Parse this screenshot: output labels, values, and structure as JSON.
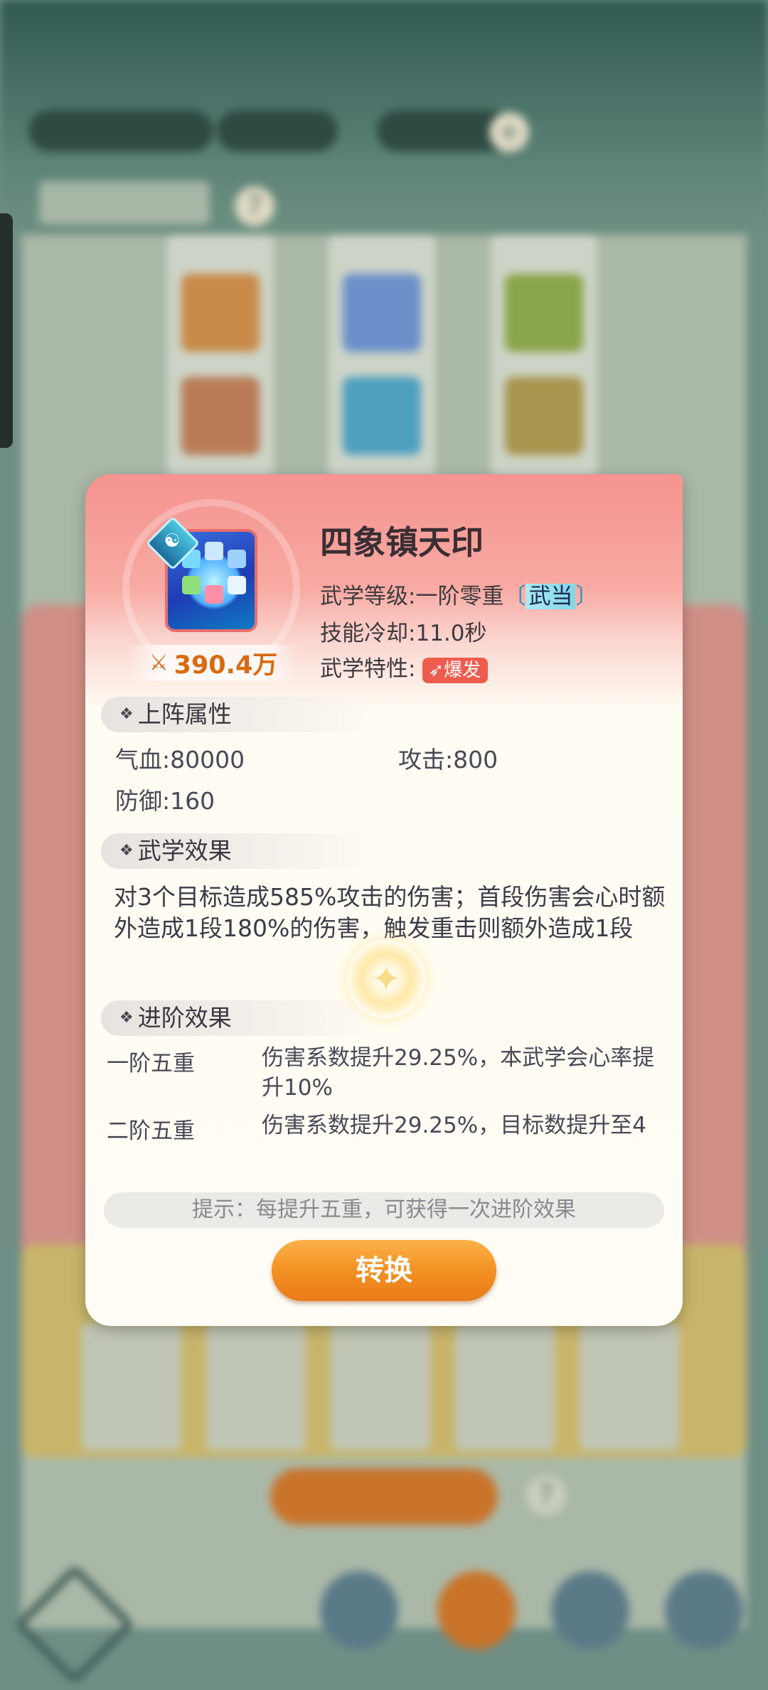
{
  "background": {
    "res_labels": [
      "",
      "",
      ""
    ],
    "title": "",
    "help": "?",
    "bottom_button": "",
    "bottom_help": "?"
  },
  "modal": {
    "skill_name": "四象镇天印",
    "power_value": "390.4万",
    "level_label": "武学等级:",
    "level_value": "一阶零重",
    "sect_open": "〔",
    "sect_name": "武当",
    "sect_close": "〕",
    "cooldown_label": "技能冷却:",
    "cooldown_value": "11.0秒",
    "trait_label": "武学特性:",
    "trait_badge": "爆发",
    "deploy_section": "上阵属性",
    "stats": {
      "hp_label": "气血:",
      "hp_value": "80000",
      "atk_label": "攻击:",
      "atk_value": "800",
      "def_label": "防御:",
      "def_value": "160"
    },
    "effect_section": "武学效果",
    "effect_text": "对3个目标造成585%攻击的伤害；首段伤害会心时额外造成1段180%的伤害，触发重击则额外造成1段",
    "advance_section": "进阶效果",
    "advances": [
      {
        "stage": "一阶五重",
        "text": "伤害系数提升29.25%，本武学会心率提升10%"
      },
      {
        "stage": "二阶五重",
        "text": "伤害系数提升29.25%，目标数提升至4"
      }
    ],
    "tip": "提示：每提升五重，可获得一次进阶效果",
    "convert_button": "转换"
  },
  "colors": {
    "accent_orange": "#f39123",
    "modal_header": "#f59390",
    "burst_badge": "#ee5c4e"
  }
}
